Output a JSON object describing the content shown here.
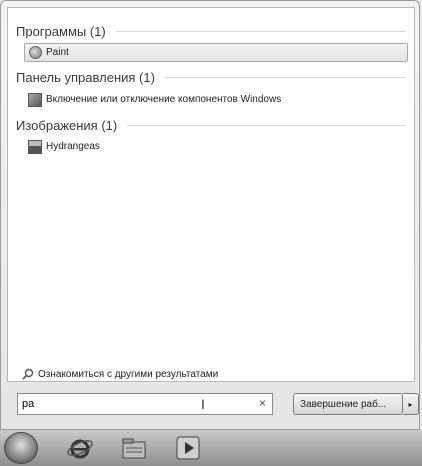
{
  "groups": [
    {
      "header": "Программы (1)",
      "items": [
        "Paint"
      ]
    },
    {
      "header": "Панель управления (1)",
      "items": [
        "Включение или отключение компонентов Windows"
      ]
    },
    {
      "header": "Изображения (1)",
      "items": [
        "Hydrangeas"
      ]
    }
  ],
  "more_results": "Ознакомиться с другими результатами",
  "search": {
    "value": "pa",
    "clear_glyph": "×"
  },
  "shutdown": {
    "label": "Завершение раб...",
    "arrow": "▸"
  },
  "taskbar": {
    "items": [
      "start-orb",
      "internet-explorer-icon",
      "windows-explorer-icon",
      "media-player-icon"
    ]
  }
}
